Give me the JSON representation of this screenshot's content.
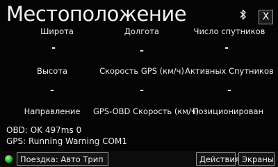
{
  "header": {
    "title": "Местоположение",
    "close_label": "X"
  },
  "grid": [
    {
      "label": "Широта",
      "value": "-"
    },
    {
      "label": "Долгота",
      "value": "-"
    },
    {
      "label": "Число спутников",
      "value": "-"
    },
    {
      "label": "Высота",
      "value": "-"
    },
    {
      "label": "Скорость GPS (км/ч)",
      "value": "-"
    },
    {
      "label": "Активных Спутников",
      "value": "-"
    },
    {
      "label": "Направление"
    },
    {
      "label": "GPS-OBD Скорость (км/ч)"
    },
    {
      "label": "Позиционирован"
    }
  ],
  "status": {
    "obd": "OBD: OK 497ms 0",
    "gps": "GPS: Running Warning COM1"
  },
  "bottom": {
    "trip_label": "Поездка: Авто Трип",
    "actions_label": "Действия",
    "screens_label": "Экраны",
    "indicator_color": "#2fc43a"
  },
  "icons": {
    "bluetooth": "bluetooth-icon"
  }
}
